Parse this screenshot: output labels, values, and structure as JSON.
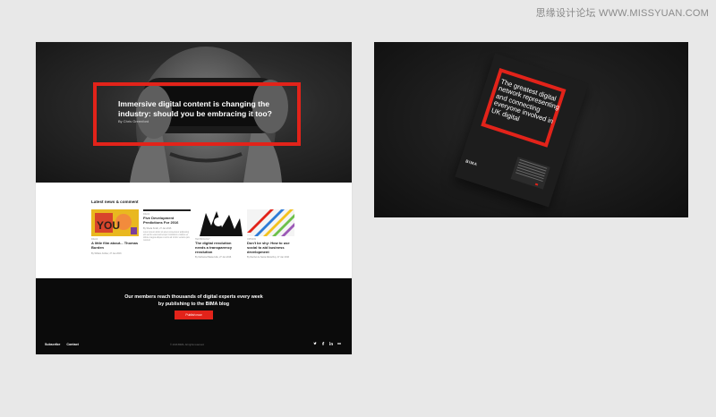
{
  "watermark": "思缘设计论坛 WWW.MISSYUAN.COM",
  "colors": {
    "accent": "#e2231a",
    "footer_bg": "#0b0b0b",
    "page_bg": "#e8e8e8"
  },
  "site": {
    "hero": {
      "title": "Immersive digital content is changing the industry: should you be embracing it too?",
      "byline": "By Chris Greenford"
    },
    "news": {
      "heading": "Latest news & comment",
      "cards": [
        {
          "tag": "IDEAS",
          "title": "A little film about... Thomas Burden",
          "meta": "By William Ambler, 27 Jan 2016",
          "text": ""
        },
        {
          "tag": "IDEAS",
          "title": "Five Development Predictions For 2016",
          "meta": "By Sheila Smith, 27 Jan 2016",
          "text": "Lorem ipsum dolor sit amet consectetur adipiscing elit sed do eiusmod tempor incididunt ut labore et dolore magna aliqua ut enim ad minim veniam quis nostrud"
        },
        {
          "tag": "TECHNOLOGY",
          "title": "The digital revolution needs a transparency revolution",
          "meta": "By Nathaniel Baskerville, 27 Jan 2016",
          "text": ""
        },
        {
          "tag": "OPINION",
          "title": "Don't be shy: How to use social to aid business development",
          "meta": "By Rachel de Santa Maria Roy, 27 Jan 2016",
          "text": ""
        }
      ]
    },
    "footer": {
      "message_line1": "Our members reach thousands of digital experts every week",
      "message_line2": "by publishing to the BIMA blog",
      "cta_label": "Publish now",
      "links": [
        "Subscribe",
        "Contact"
      ],
      "copyright": "© 2016 BIMA. All rights reserved.",
      "social_icons": [
        "twitter-icon",
        "facebook-icon",
        "linkedin-icon",
        "flickr-icon"
      ]
    }
  },
  "poster": {
    "text": "The greatest digital network representing and connecting everyone involved in UK digital",
    "logo": "BIMA"
  }
}
